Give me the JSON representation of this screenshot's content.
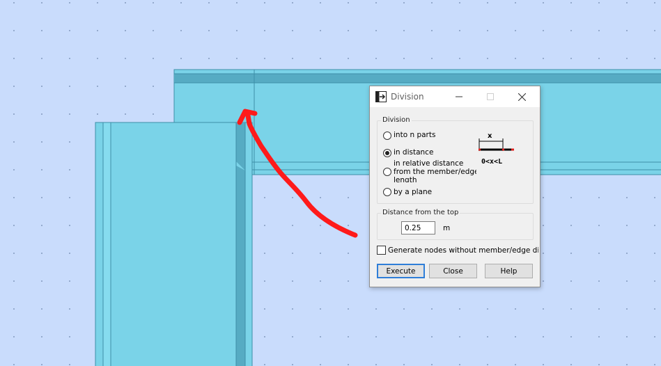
{
  "window": {
    "title": "Division",
    "minimize_symbol": "—",
    "close_symbol": "✕"
  },
  "division_group": {
    "label": "Division",
    "options": [
      {
        "label": "into n parts",
        "selected": false
      },
      {
        "label": "in distance",
        "selected": true
      },
      {
        "label_line1": "in relative distance",
        "label_line2": "from the member/edge",
        "label_line3": "length",
        "selected": false
      },
      {
        "label": "by a plane",
        "selected": false
      }
    ],
    "diagram": {
      "x_label": "x",
      "formula": "0<x<L"
    }
  },
  "distance_group": {
    "label": "Distance from the top",
    "value": "0.25",
    "unit": "m"
  },
  "generate_nodes": {
    "label": "Generate nodes without member/edge division",
    "checked": false
  },
  "buttons": {
    "execute": "Execute",
    "close": "Close",
    "help": "Help"
  },
  "colors": {
    "background": "#c9dcfc",
    "member_fill": "#7ad3e8",
    "member_edge": "#3d8fa8",
    "annotation_arrow": "#ff1a1a",
    "default_button_border": "#2f7ed8"
  }
}
